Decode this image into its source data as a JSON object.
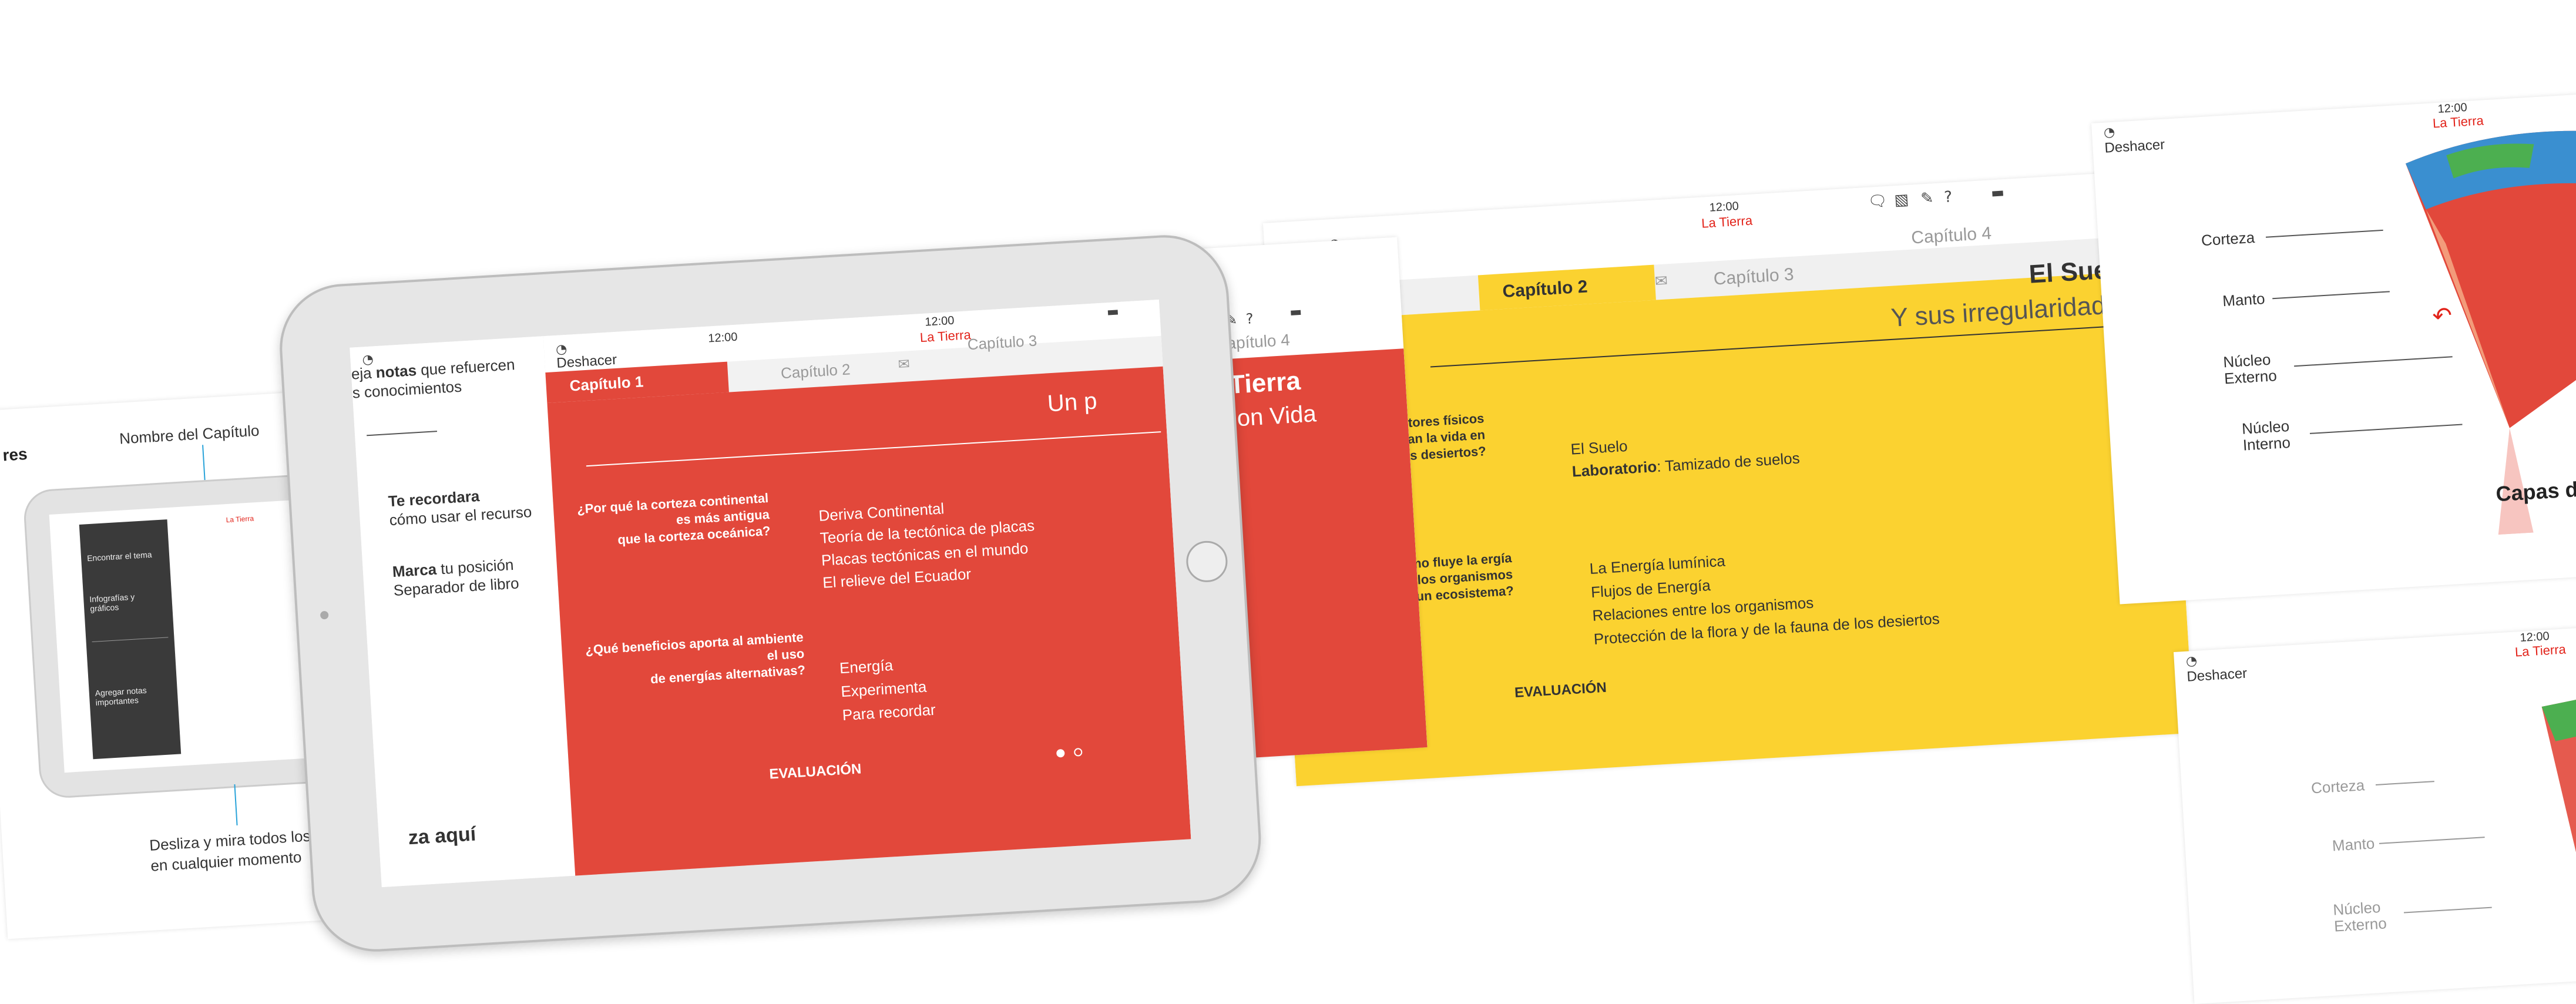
{
  "colors": {
    "red": "#e2483b",
    "yellow": "#fbd230",
    "grey_bezel": "#e6e6e6",
    "accent_red": "#e2231a"
  },
  "status": {
    "time": "12:00",
    "book_title": "La Tierra",
    "undo_label": "Deshacer"
  },
  "left_sheet": {
    "title_fragment": "res",
    "chapter_name_label": "Nombre del Capítulo",
    "swipe_hint_line1": "Desliza y mira todos los conte",
    "swipe_hint_line2": "en cualquier momento",
    "mini_menu": [
      "Encontrar el tema",
      "Infografías y gráficos",
      "Agregar notas importantes"
    ]
  },
  "tutorial": {
    "notes_line1_prefix": "eja ",
    "notes_bold": "notas",
    "notes_line1_suffix": " que refuercen",
    "notes_line2": "s conocimientos",
    "remind_bold": "Te recordara",
    "remind_line2": "cómo usar el recurso",
    "mark_bold": "Marca",
    "mark_suffix": " tu posición",
    "mark_line2": "Separador de libro",
    "start_fragment": "za aquí"
  },
  "chapter1": {
    "tabs": [
      "Capítulo 1",
      "Capítulo 2",
      "Capítulo 3",
      "Capítulo 4"
    ],
    "title": "La Tierra",
    "subtitle": "Un planeta con Vida",
    "subtitle_left": "Un p",
    "subtitle_right": "on Vida",
    "title_right": "Tierra",
    "questions": [
      {
        "q1": "¿Por qué la corteza continental",
        "q2": "es más antigua",
        "q3": "que la corteza oceánica?",
        "answers": [
          "Deriva Continental",
          "Teoría de la tectónica de placas",
          "Placas tectónicas en el mundo",
          "El relieve del Ecuador"
        ]
      },
      {
        "q1": "¿Qué beneficios aporta al ambiente",
        "q2": "el uso",
        "q3": "de energías alternativas?",
        "answers": [
          "Energía",
          "Experimenta",
          "Para recordar"
        ]
      }
    ],
    "evaluation": "EVALUACIÓN"
  },
  "chapter2": {
    "tabs": [
      "Capítulo 1",
      "Capítulo 2",
      "Capítulo 3",
      "Capítulo 4"
    ],
    "title": "El Suelo",
    "subtitle": "Y sus irregularidades",
    "questions": [
      {
        "q1": "¿Qué factores físicos",
        "q2": "condicionan la vida en",
        "q3": "los desiertos?",
        "answers": [
          "El Suelo"
        ],
        "lab_bold": "Laboratorio",
        "lab_rest": ": Tamizado de suelos"
      },
      {
        "q1": "¿Cómo fluye la ergía",
        "q2": "a través de los organismos",
        "q3": "que componen un ecosistema?",
        "answers": [
          "La Energía lumínica",
          "Flujos de Energía",
          "Relaciones entre los organismos",
          "Protección de la flora y de la fauna de los desiertos"
        ]
      }
    ],
    "evaluation": "EVALUACIÓN"
  },
  "earth": {
    "layers": [
      "Corteza",
      "Manto",
      "Núcleo Externo",
      "Núcleo Interno"
    ],
    "layers_faded": [
      "Corteza",
      "Manto",
      "Núcleo Externo"
    ],
    "caption": "Capas de la"
  },
  "page_dots": {
    "total": 2,
    "active": 0
  }
}
